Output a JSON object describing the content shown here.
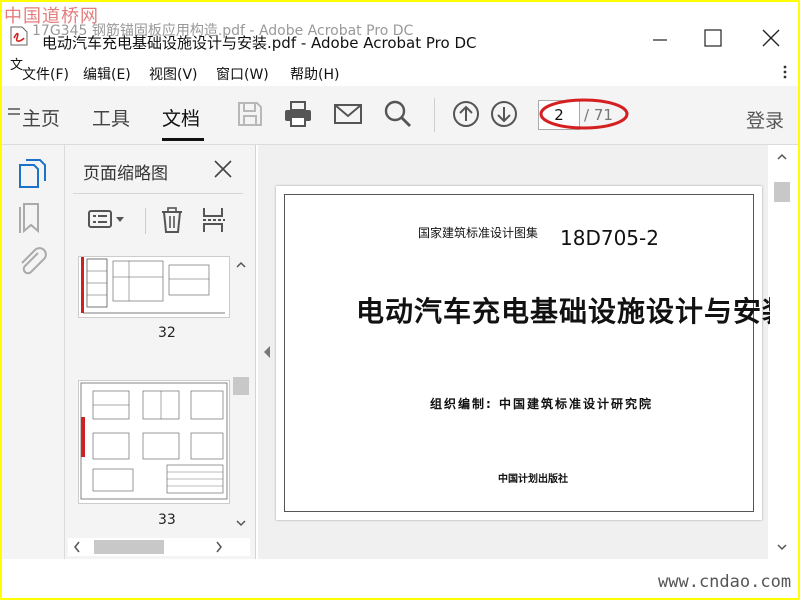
{
  "watermark_logo": "中国道桥网",
  "ghost_title": "17G345 钢筋锚固板应用构造.pdf - Adobe Acrobat Pro DC",
  "window_title": "电动汽车充电基础设施设计与安装.pdf - Adobe Acrobat Pro DC",
  "doc_glyph": "文",
  "menu": {
    "file": "文件(F)",
    "edit": "编辑(E)",
    "view": "视图(V)",
    "window": "窗口(W)",
    "help": "帮助(H)"
  },
  "toolbar": {
    "home": "主页",
    "tools": "工具",
    "document": "文档",
    "page_current": "2",
    "page_total": "/ 71",
    "login": "登录"
  },
  "panel": {
    "title": "页面缩略图",
    "thumbs": [
      {
        "label": "32"
      },
      {
        "label": "33"
      }
    ]
  },
  "document": {
    "series_label": "国家建筑标准设计图集",
    "code": "18D705-2",
    "title": "电动汽车充电基础设施设计与安装",
    "editor": "组织编制: 中国建筑标准设计研究院",
    "publisher": "中国计划出版社"
  },
  "bottom_watermark": "www.cndao.com",
  "colors": {
    "frame": "#ffff00",
    "annotation": "#d42020",
    "thumb_accent": "#cc2222"
  }
}
